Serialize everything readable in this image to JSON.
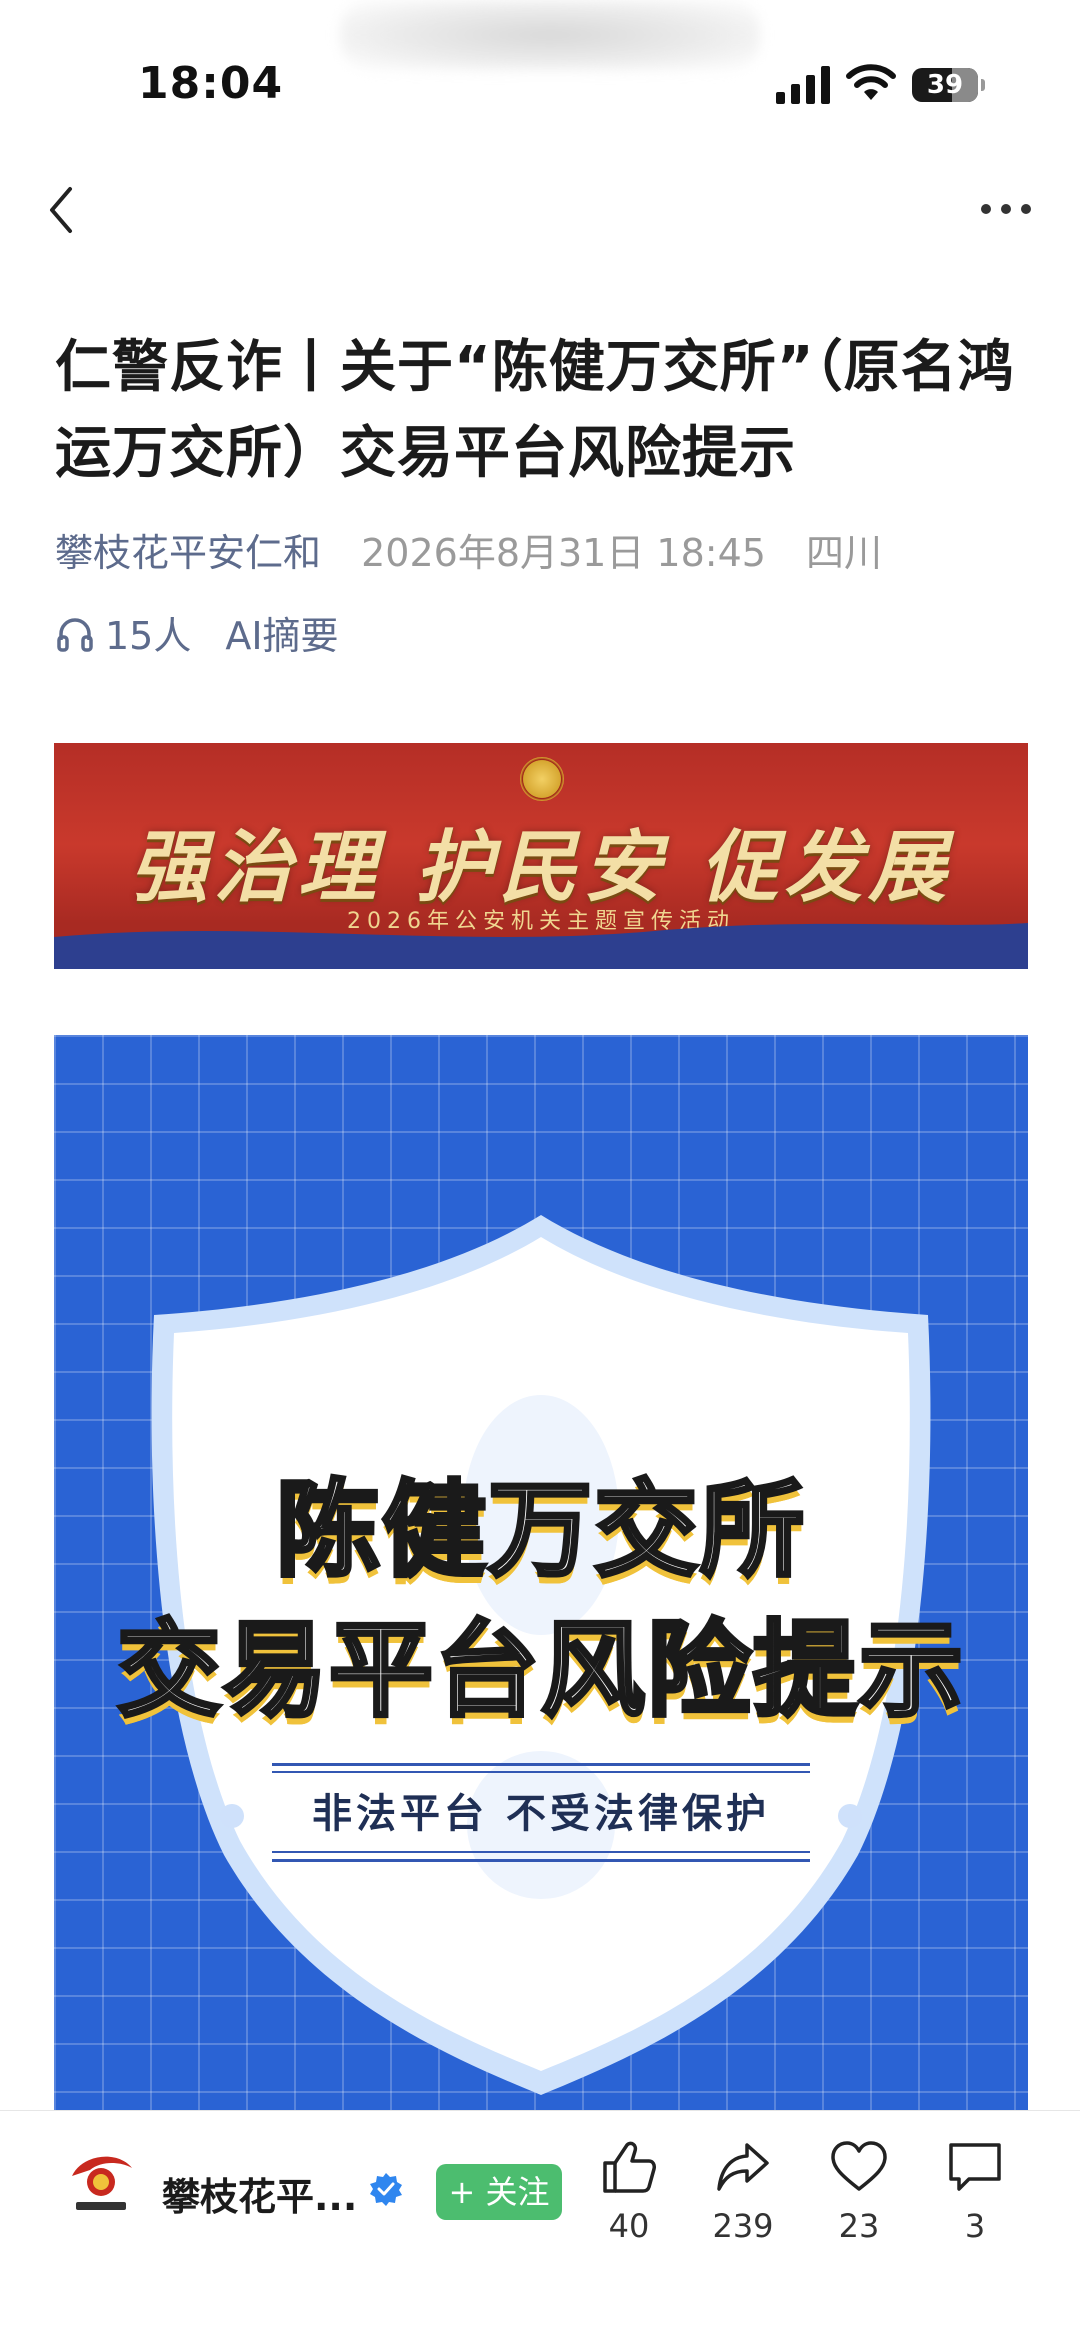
{
  "status_bar": {
    "time": "18:04",
    "battery": "39"
  },
  "nav": {
    "back_icon": "chevron-left-icon",
    "more_icon": "more-dots-icon"
  },
  "article": {
    "title": "仁警反诈丨关于“陈健万交所”（原名鸿运万交所）交易平台风险提示",
    "author": "攀枝花平安仁和",
    "datetime": "2026年8月31日 18:45",
    "region": "四川",
    "listeners": "15人",
    "ai_summary": "AI摘要"
  },
  "banner": {
    "slogan": "强治理  护民安  促发展",
    "subline": "2026年公安机关主题宣传活动"
  },
  "poster": {
    "line1": "陈健万交所",
    "line2": "交易平台风险提示",
    "tagline": "非法平台  不受法律保护"
  },
  "bottom_bar": {
    "account_name": "攀枝花平...",
    "follow_label": "+ 关注",
    "likes": "40",
    "shares": "239",
    "favorites": "23",
    "comments": "3"
  },
  "colors": {
    "poster_blue": "#2a63d4",
    "banner_red": "#c9392c",
    "follow_green": "#4cbd6f",
    "meta_blue": "#5d6b8c"
  }
}
